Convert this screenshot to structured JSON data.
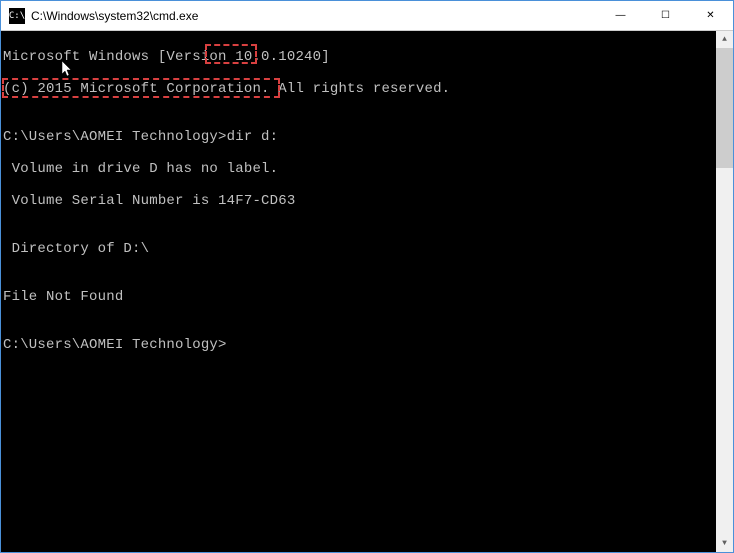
{
  "window": {
    "title": "C:\\Windows\\system32\\cmd.exe",
    "icon_label": "C:\\"
  },
  "terminal": {
    "lines": [
      "Microsoft Windows [Version 10.0.10240]",
      "(c) 2015 Microsoft Corporation. All rights reserved.",
      "",
      "C:\\Users\\AOMEI Technology>dir d:",
      " Volume in drive D has no label.",
      " Volume Serial Number is 14F7-CD63",
      "",
      " Directory of D:\\",
      "",
      "File Not Found",
      "",
      "C:\\Users\\AOMEI Technology>"
    ],
    "prompt": "C:\\Users\\AOMEI Technology>",
    "command": "dir d:",
    "version": "10.0.10240",
    "copyright_year": "2015",
    "drive_letter": "D",
    "volume_serial": "14F7-CD63"
  },
  "controls": {
    "minimize": "—",
    "maximize": "☐",
    "close": "✕"
  },
  "annotations": {
    "highlight_command": "dir d:",
    "highlight_serial_line": " Volume Serial Number is 14F7-CD63"
  }
}
